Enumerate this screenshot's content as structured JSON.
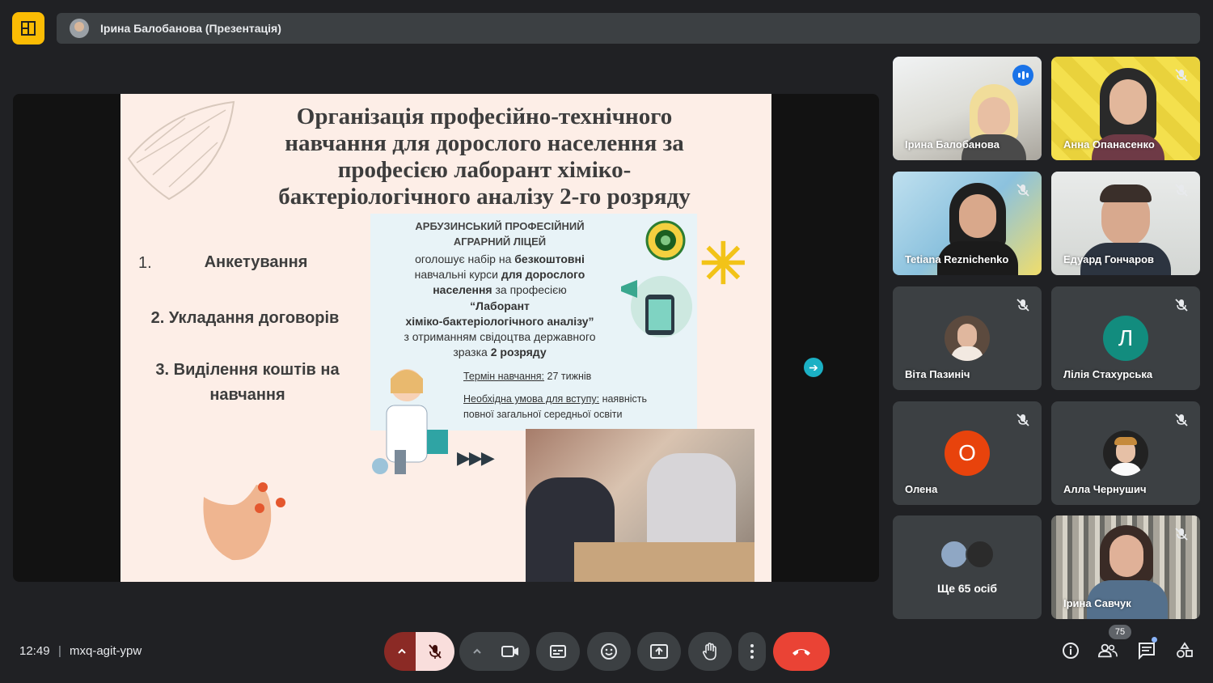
{
  "header": {
    "presenter_title": "Ірина Балобанова (Презентація)"
  },
  "slide": {
    "title": "Організація професійно-технічного навчання для дорослого населення за професією лаборант хіміко-бактеріологічного аналізу 2-го розряду",
    "list_number_1": "1.",
    "list_item_1": "Анкетування",
    "list_item_2": "2. Укладання договорів",
    "list_item_3": "3. Виділення коштів на навчання",
    "ad": {
      "school_line1": "АРБУЗИНСЬКИЙ ПРОФЕСІЙНИЙ",
      "school_line2": "АГРАРНИЙ ЛІЦЕЙ",
      "line1_a": "оголошує набір на ",
      "line1_b": "безкоштовні",
      "line2_a": "навчальні курси ",
      "line2_b": "для дорослого",
      "line3_a": "населення",
      "line3_b": " за професією",
      "line4": "“Лаборант",
      "line5": "хіміко-бактеріологічного аналізу”",
      "line6": "з отриманням свідоцтва державного",
      "line7_a": "зразка ",
      "line7_b": "2 розряду",
      "term_label": "Термін навчання:",
      "term_value": " 27 тижнів",
      "cond_label": "Необхідна умова для вступу:",
      "cond_value": " наявність",
      "cond_line2": "повної загальної середньої освіти"
    }
  },
  "participants": [
    {
      "name": "Ірина Балобанова",
      "type": "video",
      "speaking": true
    },
    {
      "name": "Анна Опанасенко",
      "type": "video",
      "muted": true
    },
    {
      "name": "Tetiana Reznichenko",
      "type": "video",
      "muted": true
    },
    {
      "name": "Едуард Гончаров",
      "type": "video",
      "muted": true
    },
    {
      "name": "Віта Пазиніч",
      "type": "photo",
      "muted": true
    },
    {
      "name": "Лілія Стахурська",
      "type": "initial",
      "initial": "Л",
      "color": "#128C7E",
      "muted": true
    },
    {
      "name": "Олена",
      "type": "initial",
      "initial": "О",
      "color": "#E8430C",
      "muted": true
    },
    {
      "name": "Алла Чернушич",
      "type": "photo",
      "muted": true
    },
    {
      "more": "Ще 65 осіб"
    },
    {
      "name": "Ірина Савчук",
      "type": "video",
      "muted": true
    }
  ],
  "footer": {
    "time": "12:49",
    "separator": "|",
    "meeting_code": "mxq-agit-ypw",
    "participant_count": "75"
  },
  "colors": {
    "end_call": "#ea4335",
    "mic_off_bg": "#f9dedc",
    "accent": "#8ab4f8"
  }
}
